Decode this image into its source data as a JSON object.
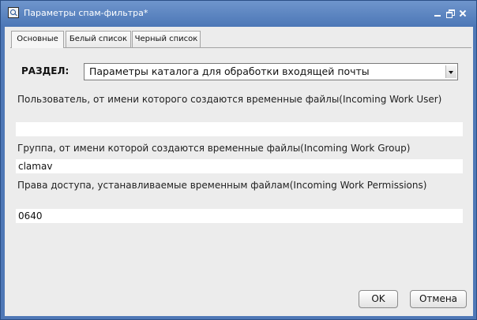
{
  "window": {
    "title": "Параметры спам-фильтра*",
    "icon": "search-icon",
    "controls": [
      "minimize-icon",
      "restore-icon",
      "close-icon"
    ]
  },
  "tabs": [
    {
      "label": "Основные",
      "active": true
    },
    {
      "label": "Белый список",
      "active": false
    },
    {
      "label": "Черный список",
      "active": false
    }
  ],
  "section": {
    "label": "РАЗДЕЛ:",
    "selected": "Параметры каталога для обработки входящей почты"
  },
  "fields": [
    {
      "label": "Пользователь, от имени которого создаются временные файлы(Incoming Work User)",
      "value": ""
    },
    {
      "label": "Группа, от имени которой создаются временные файлы(Incoming Work Group)",
      "value": "clamav"
    },
    {
      "label": "Права доступа, устанавливаемые временным файлам(Incoming Work Permissions)",
      "value": "0640"
    }
  ],
  "buttons": {
    "ok": "OK",
    "cancel": "Отмена"
  },
  "colors": {
    "title_bar": "#4c77b6",
    "client_bg": "#ececec"
  }
}
